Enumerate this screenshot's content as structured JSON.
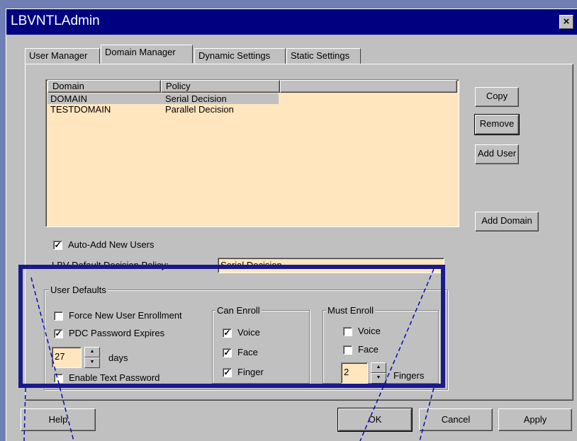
{
  "window": {
    "title": "LBVNTLAdmin",
    "close_label": "×"
  },
  "tabs": [
    {
      "label": "User Manager"
    },
    {
      "label": "Domain Manager"
    },
    {
      "label": "Dynamic Settings"
    },
    {
      "label": "Static Settings"
    }
  ],
  "domain_list": {
    "columns": [
      "Domain",
      "Policy"
    ],
    "rows": [
      {
        "domain": "DOMAIN",
        "policy": "Serial Decision",
        "selected": true
      },
      {
        "domain": "TESTDOMAIN",
        "policy": "Parallel Decision",
        "selected": false
      }
    ]
  },
  "side_buttons": {
    "copy": "Copy",
    "remove": "Remove",
    "add_user": "Add User",
    "add_domain": "Add Domain"
  },
  "auto_add": {
    "label": "Auto-Add New Users",
    "checked": true
  },
  "default_policy": {
    "label": "LBV Default Decision Policy:",
    "value": "Serial Decision"
  },
  "user_defaults": {
    "title": "User Defaults",
    "force_enrollment": {
      "label": "Force New User Enrollment",
      "checked": false
    },
    "pdc_expires": {
      "label": "PDC Password Expires",
      "checked": true
    },
    "days_value": "27",
    "days_label": "days",
    "enable_text_password": {
      "label": "Enable Text Password",
      "checked": false
    }
  },
  "can_enroll": {
    "title": "Can Enroll",
    "voice": {
      "label": "Voice",
      "checked": true
    },
    "face": {
      "label": "Face",
      "checked": true
    },
    "finger": {
      "label": "Finger",
      "checked": true
    }
  },
  "must_enroll": {
    "title": "Must Enroll",
    "voice": {
      "label": "Voice",
      "checked": false
    },
    "face": {
      "label": "Face",
      "checked": false
    },
    "fingers_value": "2",
    "fingers_label": "Fingers"
  },
  "footer_buttons": {
    "help": "Help",
    "ok": "OK",
    "cancel": "Cancel",
    "apply": "Apply"
  },
  "colors": {
    "background": "#6f7fb3",
    "titlebar": "#000080",
    "face": "#c0c0c0",
    "list_background": "#ffe6bf",
    "highlight_box": "#1a1a8c"
  }
}
